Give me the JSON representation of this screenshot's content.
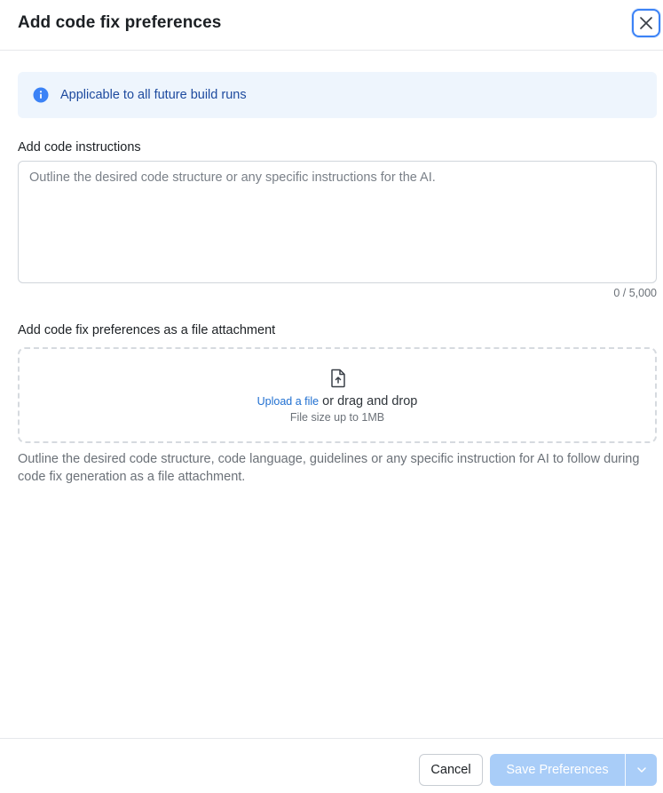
{
  "dialog": {
    "title": "Add code fix preferences",
    "close_icon": "close-icon"
  },
  "banner": {
    "icon": "info-icon",
    "text": "Applicable to all future build runs",
    "colors": {
      "background": "#eef5fd",
      "text": "#1d4a9e",
      "icon": "#3b82f6"
    }
  },
  "instructions": {
    "label": "Add code instructions",
    "value": "",
    "placeholder": "Outline the desired code structure or any specific instructions for the AI.",
    "counter": "0 / 5,000"
  },
  "attachment": {
    "label": "Add code fix preferences as a file attachment",
    "icon": "file-upload-icon",
    "upload_link": "Upload a file",
    "drag_text": "or drag and drop",
    "size_limit": "File size up to 1MB",
    "helper": "Outline the desired code structure, code language, guidelines or any specific instruction for AI to follow during code fix generation as a file attachment."
  },
  "footer": {
    "cancel_label": "Cancel",
    "save_label": "Save Preferences",
    "save_disabled": true,
    "dropdown_icon": "chevron-down-icon",
    "colors": {
      "save_background": "#a9cdf8",
      "accent": "#3b82f6"
    }
  }
}
